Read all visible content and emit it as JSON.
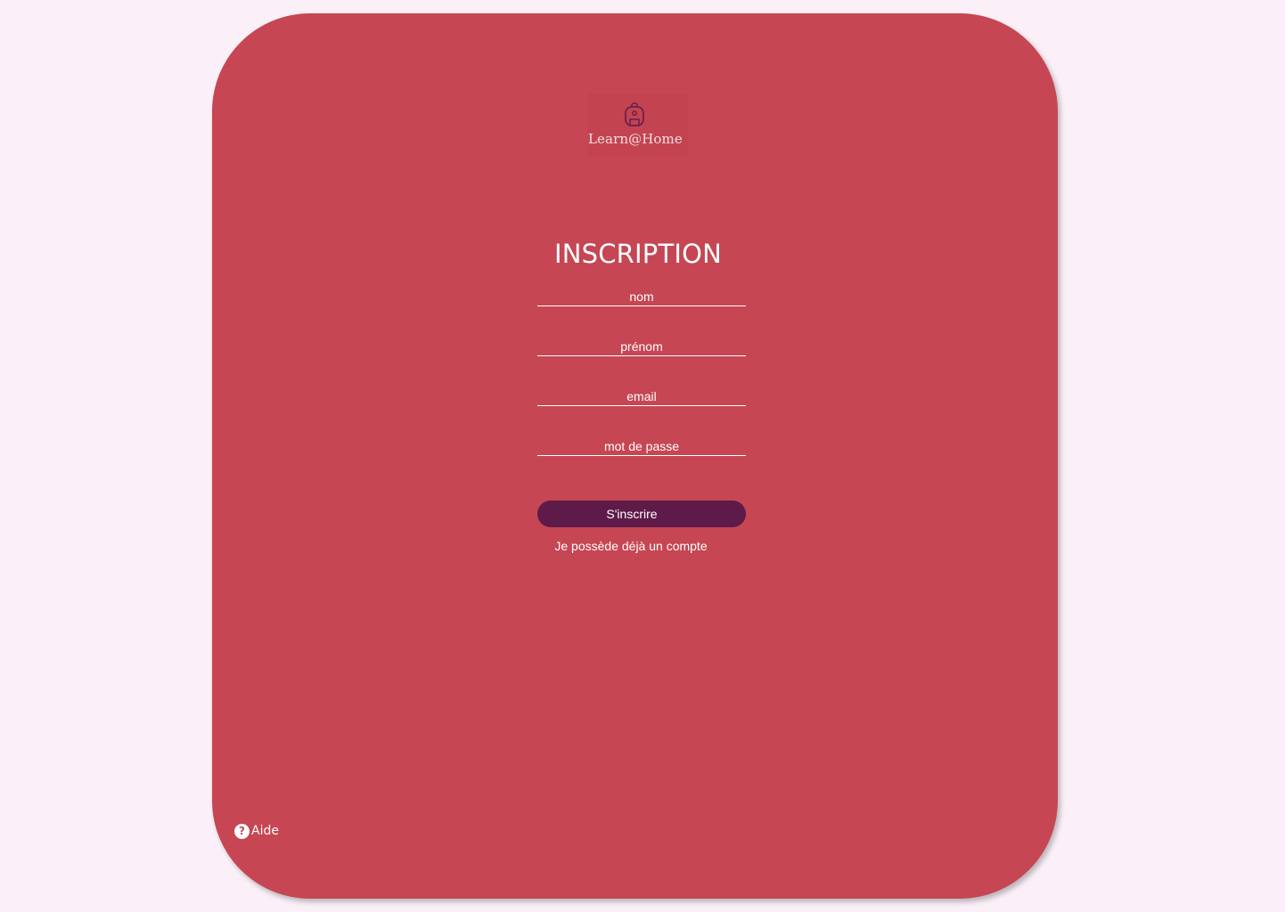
{
  "brand": {
    "name": "Learn@Home",
    "icon": "backpack-icon"
  },
  "form": {
    "title": "INSCRIPTION",
    "fields": [
      {
        "placeholder": "nom",
        "value": ""
      },
      {
        "placeholder": "prénom",
        "value": ""
      },
      {
        "placeholder": "email",
        "value": ""
      },
      {
        "placeholder": "mot de passe",
        "value": ""
      }
    ],
    "submit_label": "S'inscrire",
    "login_link": "Je possède déjà un compte"
  },
  "help": {
    "label": "Aide",
    "icon": "help-icon",
    "icon_glyph": "?"
  },
  "colors": {
    "background": "#fbf0f8",
    "card": "#c64653",
    "button": "#5e1a49",
    "text": "#ffffff",
    "logo_icon": "#6b1f4d"
  }
}
